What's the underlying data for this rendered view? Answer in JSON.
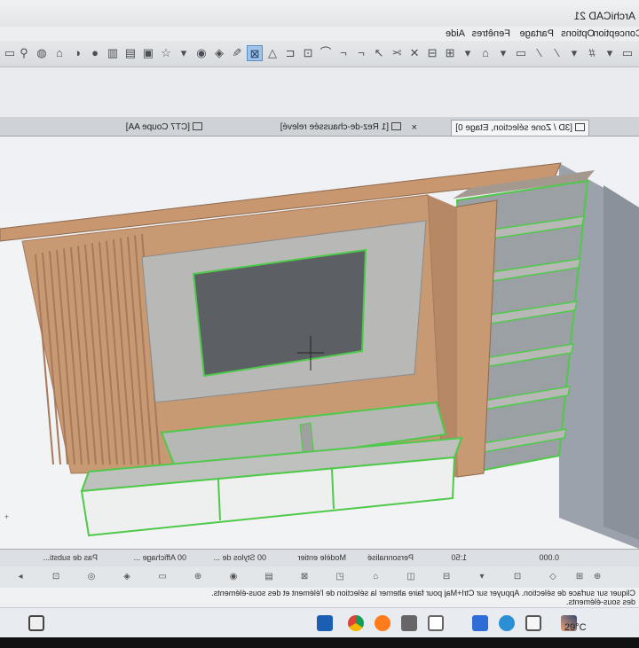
{
  "window": {
    "title": "ArchiCAD 21"
  },
  "menu": [
    "Conception",
    "Options",
    "Partage",
    "Fenêtres",
    "Aide"
  ],
  "toolbar": {
    "icons": [
      "new-file-icon",
      "open-file-icon",
      "save-icon",
      "undo-icon",
      "redo-icon",
      "grid-icon",
      "snap-icon",
      "pen-icon",
      "layer-icon",
      "surface-icon",
      "lock-icon",
      "group-icon",
      "ungroup-icon",
      "align-icon",
      "distribute-icon",
      "scissors-icon",
      "select-icon",
      "trace-icon",
      "corner-icon",
      "plan-icon",
      "elevation-icon",
      "marquee-icon",
      "star-icon",
      "image-icon",
      "sheet-icon",
      "layout-icon",
      "globe-icon",
      "render-icon",
      "cloud-icon",
      "library-icon",
      "settings-icon"
    ],
    "active_index": 21
  },
  "tabs": [
    {
      "label": "[3D / Zone sélection, Etage 0]",
      "active": true
    },
    {
      "label": "[1 Rez-de-chaussée relevé]",
      "active": false
    },
    {
      "label": "[CT7 Coupe AA]",
      "active": false
    }
  ],
  "viewport": {
    "colors": {
      "wood": "#c89a74",
      "wood_dark": "#a8795a",
      "panel_grey": "#b8b9b6",
      "tv_screen": "#5c6065",
      "selection": "#4fc94a",
      "floor": "#f4f4f5",
      "wall_dark": "#8f96a0"
    }
  },
  "statusbar": {
    "items": [
      "0.000",
      "1:50",
      "Personnalisé",
      "Modèle entier",
      "00 Stylos de ...",
      "00 Affichage ...",
      "Pas de substi..."
    ]
  },
  "hint": {
    "line1": "Cliquer sur surface de sélection. Appuyer sur Ctrl+Maj pour faire alterner la sélection de l'élément et des sous-éléments.",
    "line2": "des sous-éléments."
  },
  "taskbar": {
    "temperature": "29°C"
  }
}
